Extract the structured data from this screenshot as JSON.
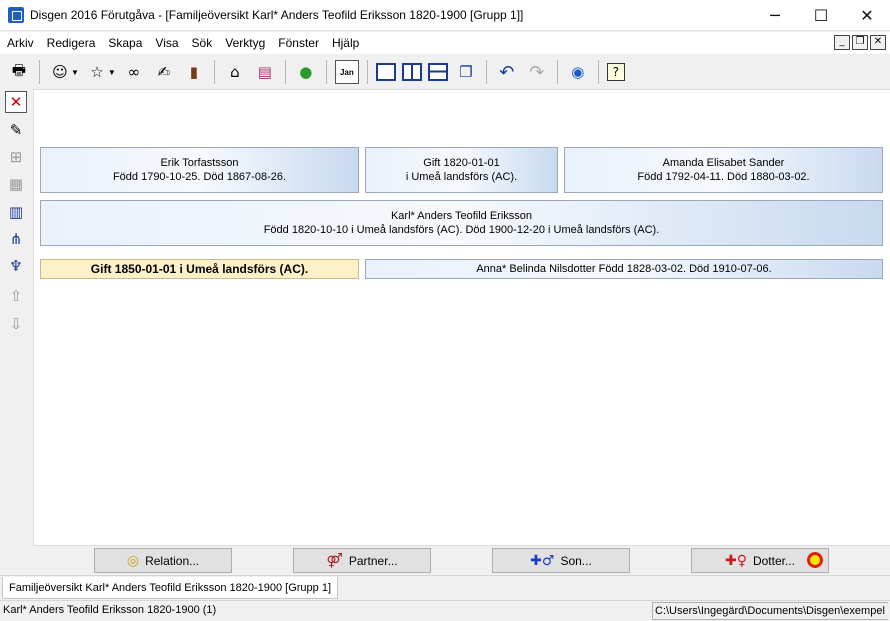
{
  "window": {
    "title": "Disgen 2016 Förutgåva - [Familjeöversikt Karl* Anders Teofild Eriksson 1820-1900 [Grupp 1]]",
    "minimize": "─",
    "maximize": "☐",
    "close": "✕"
  },
  "menu": [
    "Arkiv",
    "Redigera",
    "Skapa",
    "Visa",
    "Sök",
    "Verktyg",
    "Fönster",
    "Hjälp"
  ],
  "mdi": {
    "minimize": "_",
    "restore": "❐",
    "close": "✕"
  },
  "toolbar": {
    "icons": [
      "printer-icon",
      "person-icon",
      "person-star-icon",
      "binoculars-icon",
      "hand-note-icon",
      "book-icon",
      "home-icon",
      "books-icon",
      "map-icon",
      "calendar-icon",
      "layout-single-icon",
      "layout-columns-icon",
      "layout-rows-icon",
      "layout-cascade-icon",
      "undo-icon",
      "redo-icon",
      "globe-icon",
      "help-icon"
    ],
    "calendar_label": "Jan"
  },
  "family": {
    "father": {
      "name": "Erik Torfastsson",
      "details": "Född 1790-10-25. Död 1867-08-26."
    },
    "parents_marriage": {
      "line1": "Gift 1820-01-01",
      "line2": "i  Umeå landsförs (AC)."
    },
    "mother": {
      "name": "Amanda Elisabet Sander",
      "details": "Född 1792-04-11. Död 1880-03-02."
    },
    "main_person": {
      "name": "Karl* Anders Teofild Eriksson",
      "details": "Född 1820-10-10 i Umeå landsförs (AC). Död 1900-12-20 i Umeå landsförs (AC)."
    },
    "marriage": "Gift 1850-01-01 i Umeå landsförs (AC).",
    "spouse": "Anna* Belinda Nilsdotter Född 1828-03-02. Död 1910-07-06."
  },
  "buttons": {
    "relation": "Relation...",
    "partner": "Partner...",
    "son": "Son...",
    "daughter": "Dotter..."
  },
  "tab": {
    "label": "Familjeöversikt Karl* Anders Teofild Eriksson 1820-1900 [Grupp 1]"
  },
  "status": {
    "left": "Karl* Anders Teofild Eriksson 1820-1900 (1)",
    "right": "C:\\Users\\Ingegärd\\Documents\\Disgen\\exempel"
  }
}
